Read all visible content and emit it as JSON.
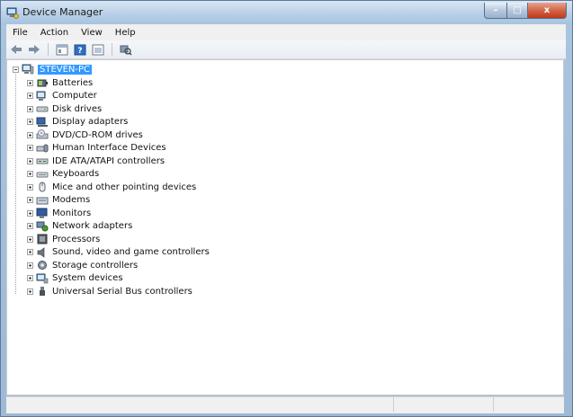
{
  "window": {
    "title": "Device Manager"
  },
  "caption": {
    "minimize": "–",
    "maximize": "□",
    "close": "x"
  },
  "menu": {
    "items": [
      "File",
      "Action",
      "View",
      "Help"
    ]
  },
  "toolbar": {
    "buttons": [
      "back-icon",
      "forward-icon",
      "properties-icon",
      "help-icon",
      "view-icon",
      "scan-hardware-icon"
    ]
  },
  "tree": {
    "root": {
      "label": "STEVEN-PC",
      "icon": "computer-icon"
    },
    "categories": [
      {
        "label": "Batteries",
        "icon": "battery-icon"
      },
      {
        "label": "Computer",
        "icon": "computer-icon"
      },
      {
        "label": "Disk drives",
        "icon": "disk-drive-icon"
      },
      {
        "label": "Display adapters",
        "icon": "display-adapter-icon"
      },
      {
        "label": "DVD/CD-ROM drives",
        "icon": "dvd-drive-icon"
      },
      {
        "label": "Human Interface Devices",
        "icon": "hid-icon"
      },
      {
        "label": "IDE ATA/ATAPI controllers",
        "icon": "ide-controller-icon"
      },
      {
        "label": "Keyboards",
        "icon": "keyboard-icon"
      },
      {
        "label": "Mice and other pointing devices",
        "icon": "mouse-icon"
      },
      {
        "label": "Modems",
        "icon": "modem-icon"
      },
      {
        "label": "Monitors",
        "icon": "monitor-icon"
      },
      {
        "label": "Network adapters",
        "icon": "network-adapter-icon"
      },
      {
        "label": "Processors",
        "icon": "processor-icon"
      },
      {
        "label": "Sound, video and game controllers",
        "icon": "sound-icon"
      },
      {
        "label": "Storage controllers",
        "icon": "storage-controller-icon"
      },
      {
        "label": "System devices",
        "icon": "system-devices-icon"
      },
      {
        "label": "Universal Serial Bus controllers",
        "icon": "usb-icon"
      }
    ]
  },
  "colors": {
    "selection": "#3399ff",
    "titlebar": "#b9d0e8",
    "close_button": "#c0391a"
  }
}
